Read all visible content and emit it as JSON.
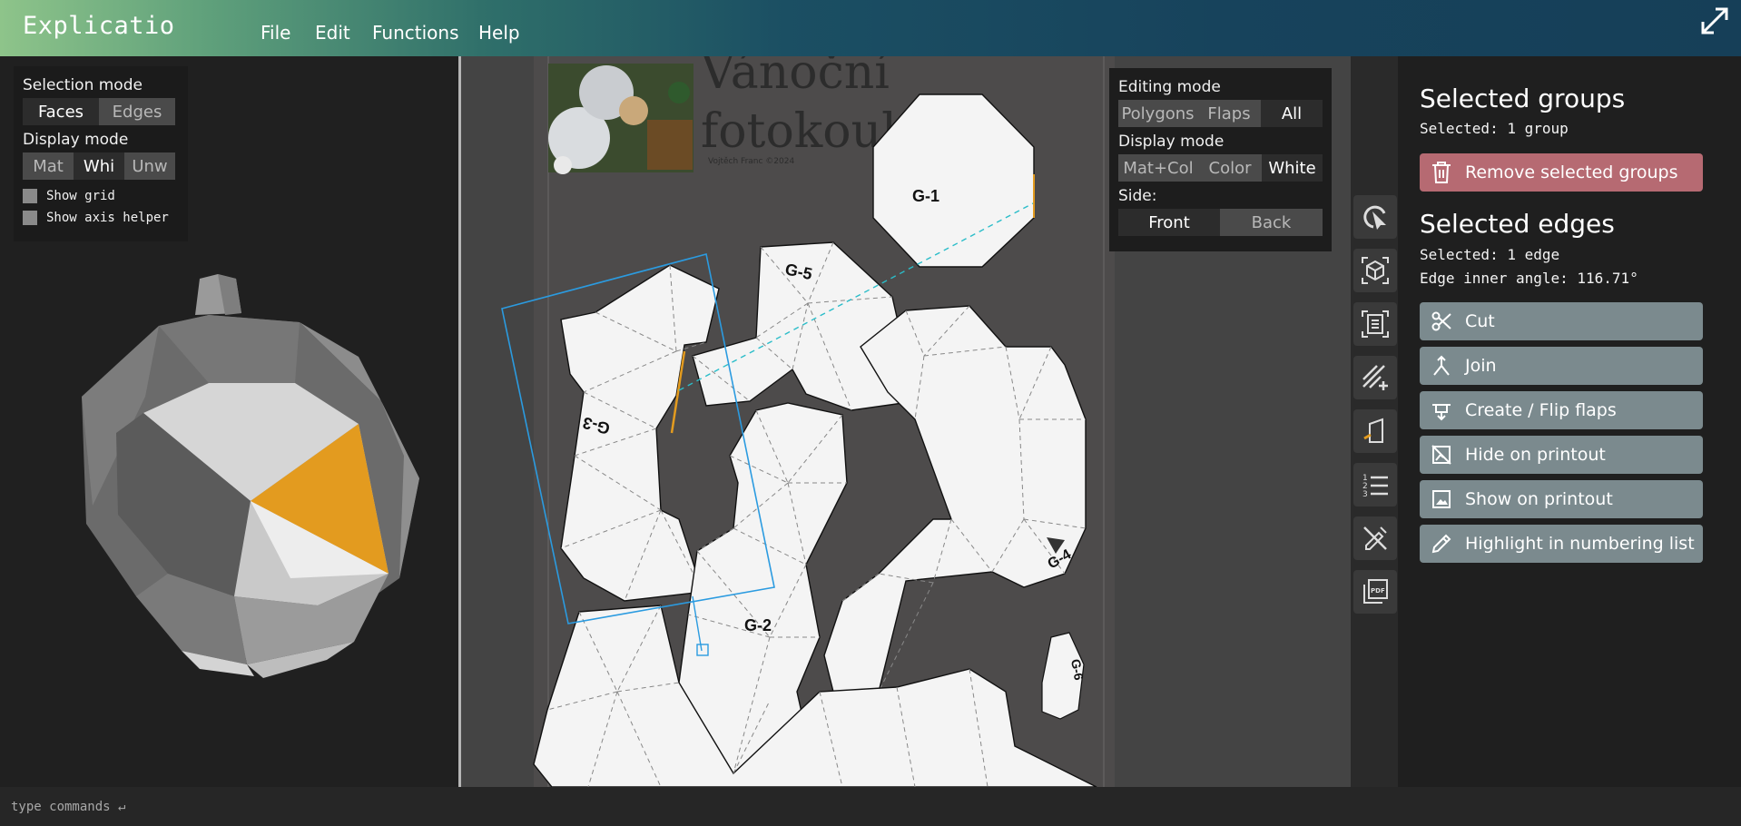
{
  "app": {
    "title": "Explicatio"
  },
  "menu": [
    "File",
    "Edit",
    "Functions",
    "Help"
  ],
  "left_panel": {
    "selection_mode_label": "Selection mode",
    "selection_modes": [
      "Faces",
      "Edges"
    ],
    "selection_active": "Faces",
    "display_mode_label": "Display mode",
    "display_modes": [
      "Mat",
      "Whi",
      "Unw"
    ],
    "display_active": "Whi",
    "show_grid_label": "Show grid",
    "show_axis_label": "Show axis helper"
  },
  "right_controls": {
    "editing_mode_label": "Editing mode",
    "editing_modes": [
      "Polygons",
      "Flaps",
      "All"
    ],
    "editing_active": "All",
    "display_mode_label": "Display mode",
    "display_modes": [
      "Mat+Col",
      "Color",
      "White"
    ],
    "display_active": "White",
    "side_label": "Side:",
    "sides": [
      "Front",
      "Back"
    ],
    "side_active": "Front"
  },
  "paper": {
    "title_line1": "Vánoční",
    "title_line2": "fotokoule",
    "author": "Vojtěch Franc ©2024",
    "groups": [
      "G-1",
      "G-2",
      "G-3",
      "G-4",
      "G-5",
      "G-6"
    ]
  },
  "tools": [
    "select-tool-icon",
    "3d-view-icon",
    "fit-page-icon",
    "add-line-icon",
    "page-icon",
    "numbering-list-icon",
    "edit-off-icon",
    "pdf-icon"
  ],
  "right_panel": {
    "groups_title": "Selected groups",
    "groups_selected": "Selected: 1 group",
    "remove_groups": "Remove selected groups",
    "edges_title": "Selected edges",
    "edges_selected": "Selected: 1 edge",
    "edge_angle": "Edge inner angle: 116.71°",
    "actions": [
      "Cut",
      "Join",
      "Create / Flip flaps",
      "Hide on printout",
      "Show on printout",
      "Highlight in numbering list"
    ]
  },
  "command": {
    "placeholder": "type commands ↵"
  },
  "colors": {
    "accent": "#e39b1f",
    "danger": "#b66a72",
    "button": "#7b8a8e",
    "selection": "#2b9be0"
  }
}
